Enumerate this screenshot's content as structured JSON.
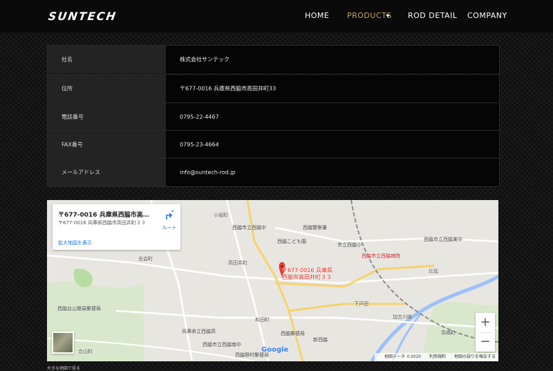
{
  "header": {
    "logo": "SUNTECH",
    "nav": [
      {
        "label": "HOME"
      },
      {
        "label": "PRODUCTS"
      },
      {
        "label": "ROD DETAIL"
      },
      {
        "label": "COMPANY"
      }
    ],
    "active_color": "#c9a268"
  },
  "company_table": [
    {
      "label": "社名",
      "value": "株式会社サンテック"
    },
    {
      "label": "住所",
      "value": "〒677-0016 兵庫県西脇市高田井町33"
    },
    {
      "label": "電話番号",
      "value": "0795-22-4467"
    },
    {
      "label": "FAX番号",
      "value": "0795-23-4664"
    },
    {
      "label": "メールアドレス",
      "value": "info@suntech-rod.jp"
    }
  ],
  "map": {
    "info_title": "〒677-0016 兵庫県西脇市高田...",
    "info_address": "〒677-0016 兵庫県西脇市高田井町３３",
    "info_link": "拡大地図を表示",
    "route_label": "ルート",
    "pin_label_line1": "〒677-0016 兵庫県",
    "pin_label_line2": "西脇市高田井町３３",
    "zoom_in": "+",
    "zoom_out": "−",
    "google": "Google",
    "attribution": [
      "地図データ ©2020",
      "利用規約",
      "地図の誤りを報告する"
    ],
    "places": [
      "小坂町",
      "西脇市立西脇中",
      "西脇警察署",
      "西脇こども園",
      "市立西脇小",
      "西脇市立西脇東中",
      "西脇市立西脇病院",
      "出会町",
      "高田井町",
      "比延",
      "西脇台山簡易郵便局",
      "和田町",
      "下戸田",
      "兵庫県立西脇高",
      "西脇市立西脇南中",
      "西脇郵便局",
      "新西脇",
      "西脇野村郵便局",
      "高嶋町",
      "合山町",
      "加古川線"
    ]
  },
  "footnote": "大きな地図で見る"
}
